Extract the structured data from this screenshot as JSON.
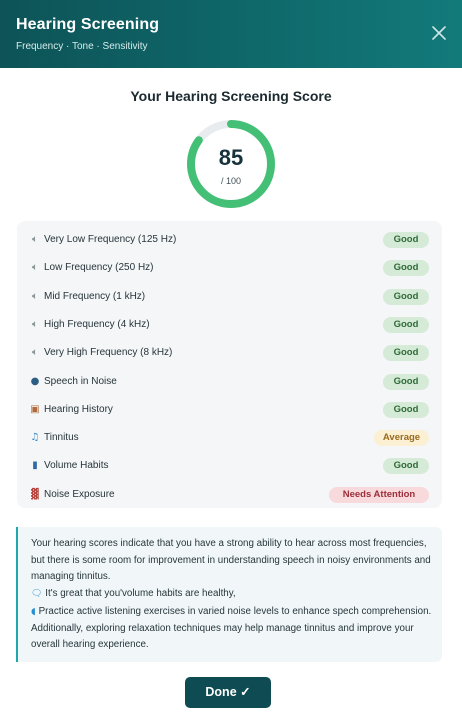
{
  "header": {
    "title": "Hearing Screening",
    "subtitle": "Frequency · Tone · Sensitivity"
  },
  "score": {
    "title": "Your Hearing Screening Score",
    "value": "85",
    "max": "/ 100",
    "fraction": 0.85,
    "color": "#43c076"
  },
  "results": [
    {
      "icon": "speaker-icon",
      "label": "Very Low Frequency (125 Hz)",
      "status": "Good",
      "kind": "good"
    },
    {
      "icon": "speaker-icon",
      "label": "Low Frequency (250 Hz)",
      "status": "Good",
      "kind": "good"
    },
    {
      "icon": "speaker-icon",
      "label": "Mid Frequency (1 kHz)",
      "status": "Good",
      "kind": "good"
    },
    {
      "icon": "speaker-icon",
      "label": "High Frequency (4 kHz)",
      "status": "Good",
      "kind": "good"
    },
    {
      "icon": "speaker-icon",
      "label": "Very High Frequency (8 kHz)",
      "status": "Good",
      "kind": "good"
    },
    {
      "icon": "speaking-head-icon",
      "label": "Speech in Noise",
      "status": "Good",
      "kind": "good"
    },
    {
      "icon": "clipboard-icon",
      "label": "Hearing History",
      "status": "Good",
      "kind": "good"
    },
    {
      "icon": "music-note-icon",
      "label": "Tinnitus",
      "status": "Average",
      "kind": "average"
    },
    {
      "icon": "tablet-icon",
      "label": "Volume Habits",
      "status": "Good",
      "kind": "good"
    },
    {
      "icon": "factory-icon",
      "label": "Noise Exposure",
      "status": "Needs Attention",
      "kind": "attention"
    }
  ],
  "summary": {
    "intro": "Your hearing scores indicate that you have a strong ability to hear across most frequencies, but there is some room for improvement in understanding speech in noisy environments and managing tinnitus.",
    "tip1": "It's great that you'volume habits are healthy,",
    "tip2": "Practice active listening exercises in varied noise levels to enhance spech comprehension. Additionally, exploring relaxation techniques may help manage tinnitus and improve your overall hearing experience."
  },
  "done_label": "Done ✓"
}
